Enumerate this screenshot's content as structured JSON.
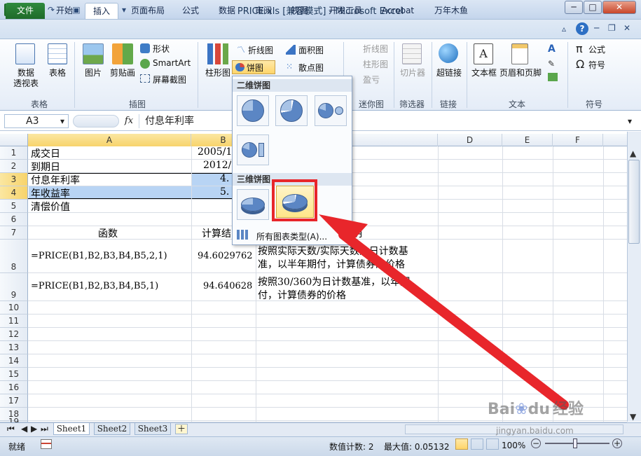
{
  "window": {
    "title": "PRICE.xls [兼容模式] - Microsoft Excel",
    "controls": {
      "minimize": "─",
      "maximize": "□",
      "close": "✕"
    }
  },
  "tabs": [
    "文件",
    "开始",
    "插入",
    "页面布局",
    "公式",
    "数据",
    "审阅",
    "视图",
    "开发工具",
    "Acrobat",
    "万年木鱼"
  ],
  "active_tab": "插入",
  "ribbon": {
    "groups": {
      "tables": {
        "label": "表格",
        "pivot": "数据\n透视表",
        "table": "表格"
      },
      "illustrations": {
        "label": "插图",
        "picture": "图片",
        "clipart": "剪贴画",
        "shapes": "形状",
        "smartart": "SmartArt",
        "screenshot": "屏幕截图"
      },
      "charts": {
        "column": "柱形图",
        "line": "折线图",
        "pie": "饼图",
        "area": "面积图",
        "scatter": "散点图"
      },
      "sparklines": {
        "label": "迷你图",
        "line": "折线图",
        "column": "柱形图",
        "winloss": "盈亏"
      },
      "filter": {
        "label": "筛选器",
        "slicer": "切片器"
      },
      "links": {
        "label": "链接",
        "hyperlink": "超链接"
      },
      "text": {
        "label": "文本",
        "textbox": "文本框",
        "header_footer": "页眉和页脚"
      },
      "symbols": {
        "label": "符号",
        "equation": "公式",
        "symbol": "符号"
      }
    }
  },
  "formula_bar": {
    "name_box": "A3",
    "fx": "fx",
    "formula": "付息年利率"
  },
  "columns": [
    "A",
    "B",
    "C",
    "D",
    "E",
    "F"
  ],
  "rows": [
    "1",
    "2",
    "3",
    "4",
    "5",
    "6",
    "7",
    "8",
    "9",
    "10",
    "11",
    "12",
    "13",
    "14",
    "15",
    "16",
    "17",
    "18",
    "19"
  ],
  "cells": {
    "A1": "成交日",
    "B1": "2005/1",
    "A2": "到期日",
    "B2": "2012/",
    "A3": "付息年利率",
    "B3": "4.",
    "A4": "年收益率",
    "B4": "5.",
    "A5": "清偿价值",
    "A7": "函数",
    "B7": "计算结",
    "C7": "明",
    "A8": "=PRICE(B1,B2,B3,B4,B5,2,1)",
    "B8": "94.6029762",
    "C8a": "按照实际天数/实际天数为日计数基",
    "C8b": "准，以半年期付，计算债券的价格",
    "A9": "=PRICE(B1,B2,B3,B4,B5,1)",
    "B9": "94.640628",
    "C9a": "按照30/360为日计数基准，以年期",
    "C9b": "付，计算债券的价格"
  },
  "dropdown": {
    "section_2d": "二维饼图",
    "section_3d": "三维饼图",
    "all_types": "所有图表类型(A)..."
  },
  "sheets": [
    "Sheet1",
    "Sheet2",
    "Sheet3"
  ],
  "status": {
    "ready": "就绪",
    "count": "数值计数: 2",
    "max": "最大值: 0.05132",
    "zoom": "100%"
  },
  "watermark": {
    "brand": "Bai",
    "brand2": "du",
    "tail": "经验",
    "url": "jingyan.baidu.com"
  },
  "colors": {
    "excel_green": "#1f6b2a",
    "selection": "#b8d4f4",
    "arrow_red": "#e8262b",
    "highlight": "#ffe68a"
  }
}
